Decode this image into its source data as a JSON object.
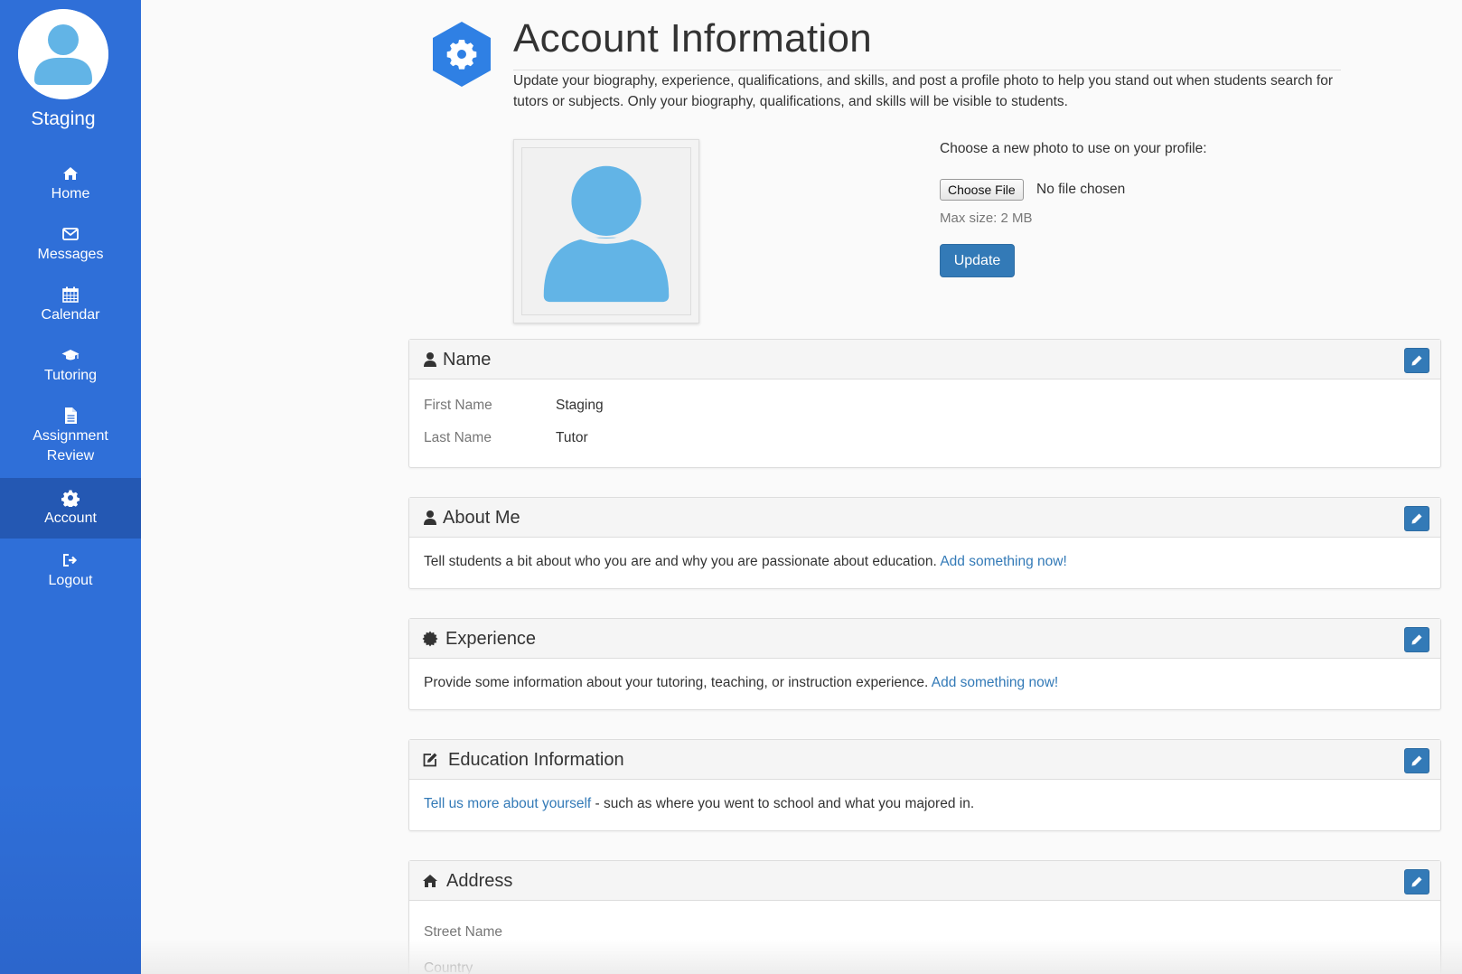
{
  "sidebar": {
    "brand": "Staging",
    "avatar_icon": "user-avatar-icon",
    "items": [
      {
        "label": "Home",
        "icon": "home-icon"
      },
      {
        "label": "Messages",
        "icon": "envelope-icon"
      },
      {
        "label": "Calendar",
        "icon": "calendar-icon"
      },
      {
        "label": "Tutoring",
        "icon": "graduation-cap-icon"
      },
      {
        "label": "Assignment Review",
        "icon": "file-icon"
      },
      {
        "label": "Account",
        "icon": "gear-icon",
        "active": true
      },
      {
        "label": "Logout",
        "icon": "sign-out-icon"
      }
    ]
  },
  "header": {
    "title": "Account Information",
    "description": "Update your biography, experience, qualifications, and skills, and post a profile photo to help you stand out when students search for tutors or subjects. Only your biography, qualifications, and skills will be visible to students."
  },
  "photo": {
    "choose_label": "Choose a new photo to use on your profile:",
    "file_button": "Choose File",
    "no_file": "No file chosen",
    "max_size": "Max size: 2 MB",
    "update_button": "Update"
  },
  "panels": {
    "name": {
      "title": "Name",
      "fields": [
        {
          "label": "First Name",
          "value": "Staging"
        },
        {
          "label": "Last Name",
          "value": "Tutor"
        }
      ]
    },
    "about": {
      "title": "About Me",
      "text": "Tell students a bit about who you are and why you are passionate about education.",
      "link": "Add something now!"
    },
    "experience": {
      "title": "Experience",
      "text": "Provide some information about your tutoring, teaching, or instruction experience.",
      "link": "Add something now!"
    },
    "education": {
      "title": "Education Information",
      "link": "Tell us more about yourself",
      "text": " - such as where you went to school and what you majored in."
    },
    "address": {
      "title": "Address",
      "fields": [
        {
          "label": "Street Name"
        },
        {
          "label": "Country"
        }
      ]
    }
  },
  "colors": {
    "sidebar": "#2f6fd8",
    "sidebar_active": "#2458b3",
    "accent": "#337ab7",
    "avatar": "#62b4e6"
  }
}
